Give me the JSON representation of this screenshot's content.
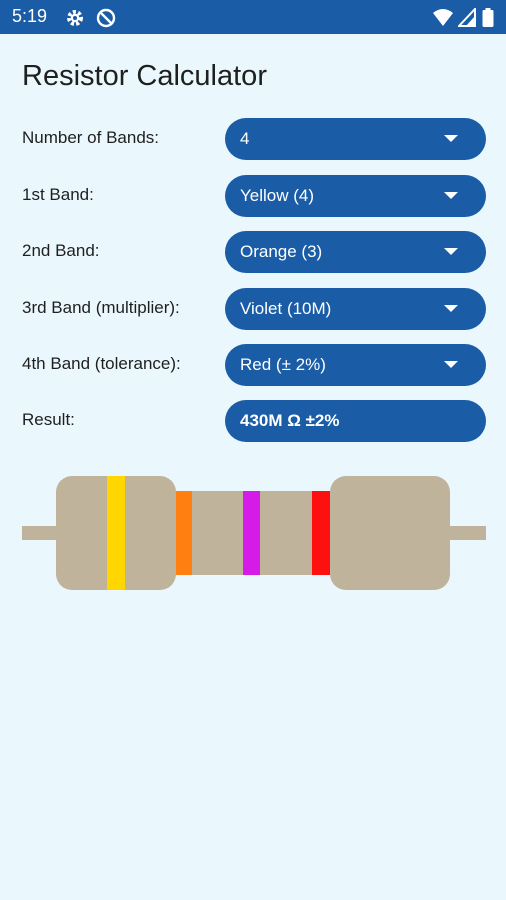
{
  "status_bar": {
    "time": "5:19",
    "icons": [
      "settings-icon",
      "do-not-disturb-icon",
      "wifi-icon",
      "signal-icon",
      "battery-icon"
    ]
  },
  "title": "Resistor Calculator",
  "rows": [
    {
      "label": "Number of Bands:",
      "value": "4"
    },
    {
      "label": "1st Band:",
      "value": "Yellow (4)"
    },
    {
      "label": "2nd Band:",
      "value": "Orange (3)"
    },
    {
      "label": "3rd Band (multiplier):",
      "value": "Violet (10M)"
    },
    {
      "label": "4th Band (tolerance):",
      "value": "Red (± 2%)"
    }
  ],
  "result": {
    "label": "Result:",
    "value": "430M Ω ±2%"
  },
  "resistor_bands": [
    {
      "name": "Yellow",
      "color": "#FFD600"
    },
    {
      "name": "Orange",
      "color": "#FF8010"
    },
    {
      "name": "Violet",
      "color": "#D61BE8"
    },
    {
      "name": "Red",
      "color": "#FF1010"
    }
  ],
  "colors": {
    "accent": "#1A5CA6",
    "background": "#EAF8FE",
    "resistor_body": "#BFB39C"
  }
}
